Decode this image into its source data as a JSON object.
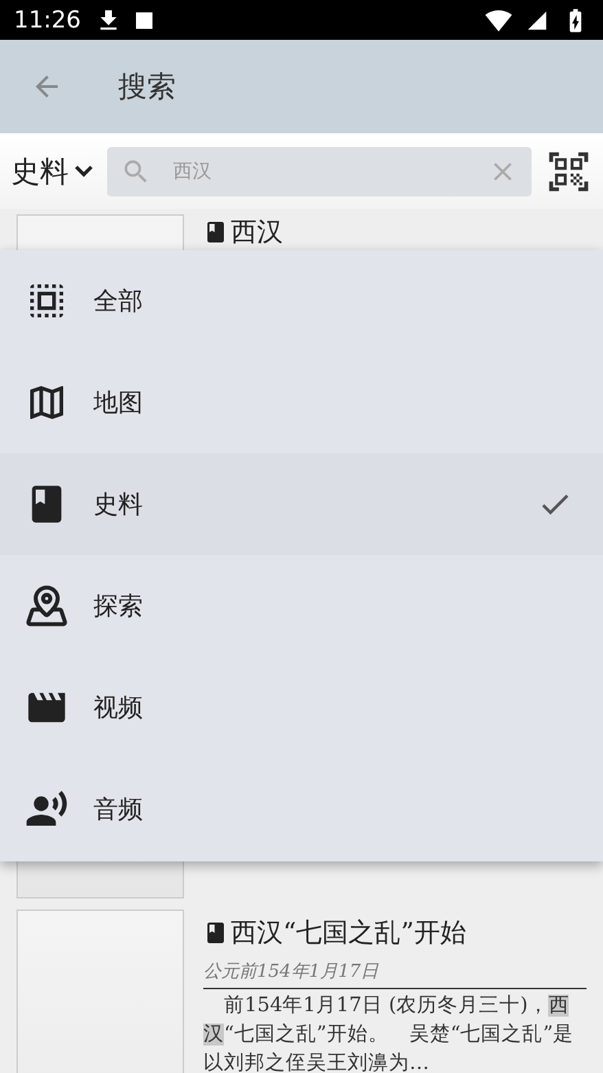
{
  "status_bar": {
    "time": "11:26"
  },
  "app_bar": {
    "title": "搜索"
  },
  "search_bar": {
    "category": "史料",
    "value": "西汉"
  },
  "category_menu": {
    "expanded": true,
    "items": [
      {
        "kind": "all",
        "label": "全部",
        "selected": false
      },
      {
        "kind": "map",
        "label": "地图",
        "selected": false
      },
      {
        "kind": "records",
        "label": "史料",
        "selected": true
      },
      {
        "kind": "explore",
        "label": "探索",
        "selected": false
      },
      {
        "kind": "video",
        "label": "视频",
        "selected": false
      },
      {
        "kind": "audio",
        "label": "音频",
        "selected": false
      }
    ]
  },
  "results": [
    {
      "kind": "title_only",
      "title": "西汉"
    },
    {
      "kind": "thumbnail_only"
    },
    {
      "kind": "full",
      "title": "西汉“七国之乱”开始",
      "date": "公元前154年1月17日",
      "body": [
        {
          "text": "　前154年1月17日 (农历冬月三十)，",
          "highlighted": false
        },
        {
          "text": "西汉",
          "highlighted": true
        },
        {
          "text": "“七国之乱”开始。　吴楚“七国之乱”是以刘邦之侄吴王刘濞为…",
          "highlighted": false
        }
      ]
    }
  ]
}
